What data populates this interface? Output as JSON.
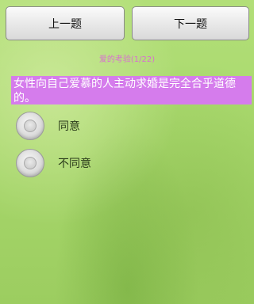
{
  "toolbar": {
    "prev_label": "上一题",
    "next_label": "下一题"
  },
  "quiz": {
    "counter": "爱的考验(1/22)",
    "question": "女性向自己爱慕的人主动求婚是完全合乎道德的。",
    "options": [
      {
        "label": "同意",
        "checked": false
      },
      {
        "label": "不同意",
        "checked": false
      }
    ]
  }
}
